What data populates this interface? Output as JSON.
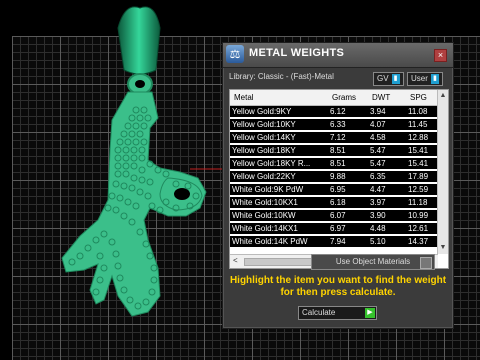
{
  "window": {
    "title": "METAL WEIGHTS",
    "library_label": "Library: Classic - (Fast)-Metal",
    "toggle_gv": "GV",
    "toggle_user": "User"
  },
  "table": {
    "columns": [
      "Metal",
      "Grams",
      "DWT",
      "SPG"
    ],
    "rows": [
      {
        "metal": "Yellow Gold:9KY",
        "grams": "6.12",
        "dwt": "3.94",
        "spg": "11.08"
      },
      {
        "metal": "Yellow Gold:10KY",
        "grams": "6.33",
        "dwt": "4.07",
        "spg": "11.45"
      },
      {
        "metal": "Yellow Gold:14KY",
        "grams": "7.12",
        "dwt": "4.58",
        "spg": "12.88"
      },
      {
        "metal": "Yellow Gold:18KY",
        "grams": "8.51",
        "dwt": "5.47",
        "spg": "15.41"
      },
      {
        "metal": "Yellow Gold:18KY R...",
        "grams": "8.51",
        "dwt": "5.47",
        "spg": "15.41"
      },
      {
        "metal": "Yellow Gold:22KY",
        "grams": "9.88",
        "dwt": "6.35",
        "spg": "17.89"
      },
      {
        "metal": "White Gold:9K PdW",
        "grams": "6.95",
        "dwt": "4.47",
        "spg": "12.59"
      },
      {
        "metal": "White Gold:10KX1",
        "grams": "6.18",
        "dwt": "3.97",
        "spg": "11.18"
      },
      {
        "metal": "White Gold:10KW",
        "grams": "6.07",
        "dwt": "3.90",
        "spg": "10.99"
      },
      {
        "metal": "White Gold:14KX1",
        "grams": "6.97",
        "dwt": "4.48",
        "spg": "12.61"
      },
      {
        "metal": "White Gold:14K PdW",
        "grams": "7.94",
        "dwt": "5.10",
        "spg": "14.37"
      }
    ]
  },
  "use_object_materials": "Use Object Materials",
  "message": "Highlight the item you want to find the weight for then press calculate.",
  "calculate_label": "Calculate",
  "colors": {
    "model": "#3bbf8a",
    "accent": "#ffd400",
    "go": "#35c12c"
  }
}
